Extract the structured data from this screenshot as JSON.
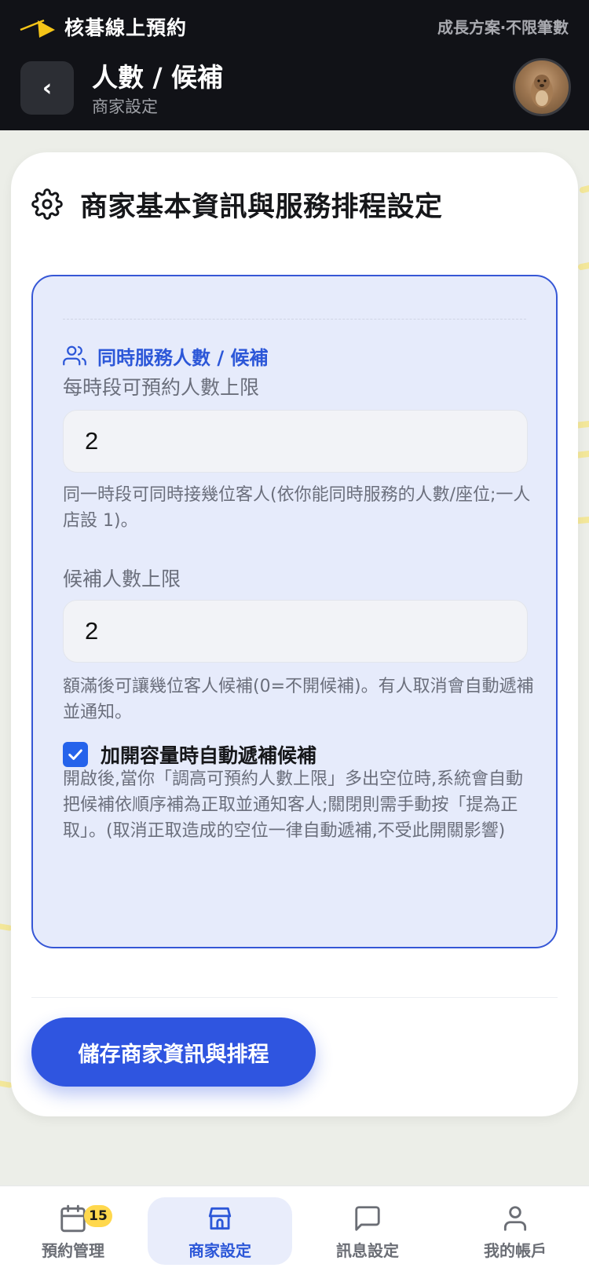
{
  "header": {
    "app_name": "核碁線上預約",
    "plan_label": "成長方案‧不限筆數",
    "back_label": "‹",
    "title": "人數 / 候補",
    "subtitle": "商家設定"
  },
  "card": {
    "title": "商家基本資訊與服務排程設定",
    "section_label": "同時服務人數 / 候補",
    "capacity": {
      "label": "每時段可預約人數上限",
      "value": "2",
      "helper": "同一時段可同時接幾位客人(依你能同時服務的人數/座位;一人店設 1)。"
    },
    "waitlist": {
      "label": "候補人數上限",
      "value": "2",
      "helper": "額滿後可讓幾位客人候補(0=不開候補)。有人取消會自動遞補並通知。"
    },
    "auto_fill": {
      "checked": true,
      "label": "加開容量時自動遞補候補",
      "helper": "開啟後,當你「調高可預約人數上限」多出空位時,系統會自動把候補依順序補為正取並通知客人;關閉則需手動按「提為正取」。(取消正取造成的空位一律自動遞補,不受此開關影響)"
    },
    "save_label": "儲存商家資訊與排程"
  },
  "bottom_nav": {
    "items": [
      {
        "label": "預約管理",
        "icon": "calendar-icon",
        "badge": "15"
      },
      {
        "label": "商家設定",
        "icon": "store-icon",
        "active": true
      },
      {
        "label": "訊息設定",
        "icon": "chat-bubble-icon"
      },
      {
        "label": "我的帳戶",
        "icon": "user-icon"
      }
    ]
  },
  "colors": {
    "topbar": "#111217",
    "accent": "#2f55e0",
    "panel_bg": "#e6ebfb",
    "panel_border": "#3657d6",
    "badge": "#ffd84d",
    "brand_yellow": "#f5c518"
  }
}
